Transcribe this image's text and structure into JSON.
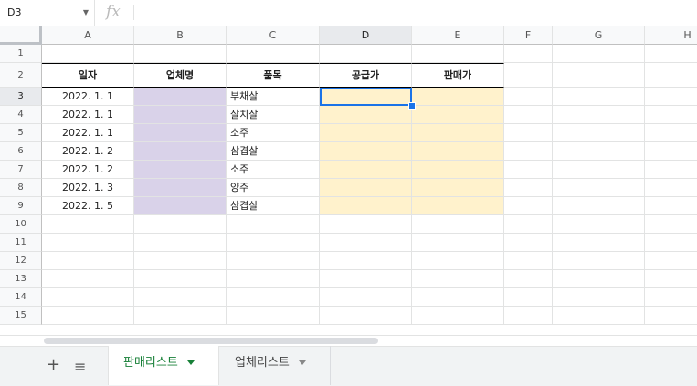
{
  "formula_bar": {
    "name_box": "D3",
    "fx_icon": "fx-icon",
    "value": ""
  },
  "columns": [
    "A",
    "B",
    "C",
    "D",
    "E",
    "F",
    "G",
    "H"
  ],
  "rows": [
    "1",
    "2",
    "3",
    "4",
    "5",
    "6",
    "7",
    "8",
    "9",
    "10",
    "11",
    "12",
    "13",
    "14",
    "15"
  ],
  "active_cell": "D3",
  "table": {
    "headers": [
      "일자",
      "업체명",
      "품목",
      "공급가",
      "판매가"
    ],
    "rows": [
      {
        "date": "2022. 1. 1",
        "vendor": "",
        "item": "부채살",
        "supply": "",
        "sale": ""
      },
      {
        "date": "2022. 1. 1",
        "vendor": "",
        "item": "살치살",
        "supply": "",
        "sale": ""
      },
      {
        "date": "2022. 1. 1",
        "vendor": "",
        "item": "소주",
        "supply": "",
        "sale": ""
      },
      {
        "date": "2022. 1. 2",
        "vendor": "",
        "item": "삼겹살",
        "supply": "",
        "sale": ""
      },
      {
        "date": "2022. 1. 2",
        "vendor": "",
        "item": "소주",
        "supply": "",
        "sale": ""
      },
      {
        "date": "2022. 1. 3",
        "vendor": "",
        "item": "양주",
        "supply": "",
        "sale": ""
      },
      {
        "date": "2022. 1. 5",
        "vendor": "",
        "item": "삼겹살",
        "supply": "",
        "sale": ""
      }
    ]
  },
  "colors": {
    "vendor_fill": "#d9d2e9",
    "price_fill": "#fff2cc",
    "selection": "#1a73e8",
    "active_tab": "#188038"
  },
  "tabs": [
    {
      "label": "판매리스트",
      "active": true
    },
    {
      "label": "업체리스트",
      "active": false
    }
  ],
  "tab_bar": {
    "add_icon": "plus-icon",
    "list_icon": "all-sheets-icon"
  }
}
